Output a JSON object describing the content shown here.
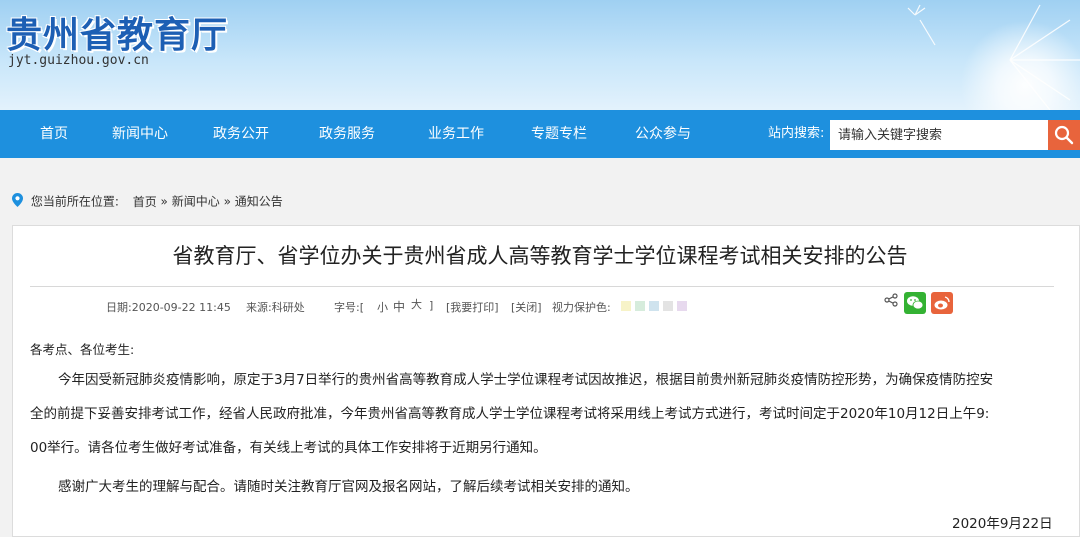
{
  "header": {
    "site_title": "贵州省教育厅",
    "site_url": "jyt.guizhou.gov.cn"
  },
  "nav": {
    "items": [
      "首页",
      "新闻中心",
      "政务公开",
      "政务服务",
      "业务工作",
      "专题专栏",
      "公众参与"
    ],
    "search_label": "站内搜索:",
    "search_placeholder": "请输入关键字搜索"
  },
  "breadcrumb": {
    "prefix": "您当前所在位置:",
    "path": [
      "首页",
      "»",
      "新闻中心",
      "»",
      "通知公告"
    ]
  },
  "article": {
    "title": "省教育厅、省学位办关于贵州省成人高等教育学士学位课程考试相关安排的公告",
    "meta": {
      "date": "日期:2020-09-22 11:45",
      "source": "来源:科研处",
      "font_label": "字号:[",
      "font_small": "小",
      "font_medium": "中",
      "font_large": "大",
      "font_close": "]",
      "print": "[我要打印]",
      "close": "[关闭]",
      "eye_care": "视力保护色:"
    },
    "swatch_colors": [
      "#f7f3c8",
      "#d6ecdc",
      "#cfe3ee",
      "#e3e3e3",
      "#e7d9ee"
    ],
    "salutation": "各考点、各位考生:",
    "para1_line1": "今年因受新冠肺炎疫情影响，原定于3月7日举行的贵州省高等教育成人学士学位课程考试因故推迟，根据目前贵州新冠肺炎疫情防控形势，为确保疫情防控安",
    "para1_line2": "全的前提下妥善安排考试工作，经省人民政府批准，今年贵州省高等教育成人学士学位课程考试将采用线上考试方式进行，考试时间定于2020年10月12日上午9:",
    "para1_line3": "00举行。请各位考生做好考试准备，有关线上考试的具体工作安排将于近期另行通知。",
    "para2": "感谢广大考生的理解与配合。请随时关注教育厅官网及报名网站，了解后续考试相关安排的通知。",
    "date_sign": "2020年9月22日"
  },
  "colors": {
    "nav_bg": "#1e90de",
    "search_btn": "#e8643c",
    "title_blue": "#1d5fb4",
    "wechat": "#34b233",
    "weibo": "#e8643c"
  },
  "icons": [
    "map-pin-icon",
    "search-icon",
    "share-icon",
    "wechat-icon",
    "weibo-icon"
  ]
}
